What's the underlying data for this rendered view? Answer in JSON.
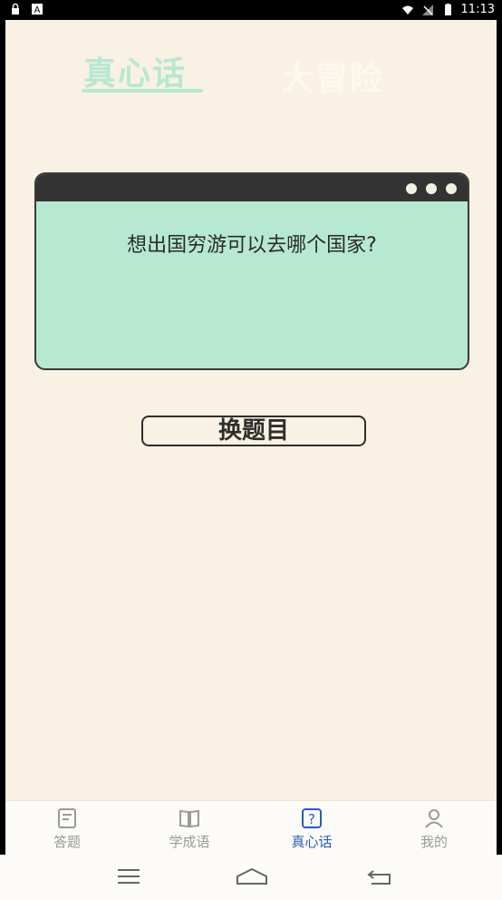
{
  "status_bar": {
    "time": "11:13",
    "icons": [
      "lock-icon",
      "a-icon",
      "wifi-icon",
      "signal-icon",
      "battery-icon"
    ]
  },
  "tabs": {
    "truth_label": "真心话",
    "dare_label": "大冒险",
    "active": "truth"
  },
  "card": {
    "question": "想出国穷游可以去哪个国家?"
  },
  "switch_button_label": "换题目",
  "bottom_nav": {
    "items": [
      {
        "label": "答题",
        "icon": "quiz-icon"
      },
      {
        "label": "学成语",
        "icon": "book-icon"
      },
      {
        "label": "真心话",
        "icon": "question-icon"
      },
      {
        "label": "我的",
        "icon": "profile-icon"
      }
    ],
    "active_index": 2
  },
  "system_nav": {
    "icons": [
      "menu-icon",
      "home-icon",
      "back-icon"
    ]
  },
  "colors": {
    "background": "#f9f1e3",
    "card_fill": "#b6e8d2",
    "card_header": "#333333",
    "accent_blue": "#2a5bbf"
  }
}
